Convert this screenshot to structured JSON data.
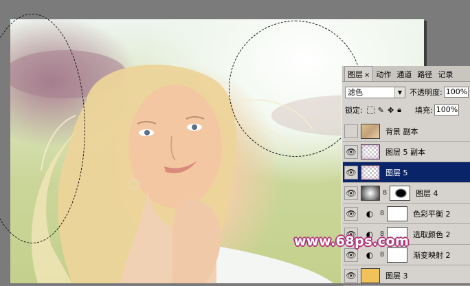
{
  "panel": {
    "tabs": [
      {
        "label": "图层",
        "close": "×",
        "active": true
      },
      {
        "label": "动作"
      },
      {
        "label": "通道"
      },
      {
        "label": "路径"
      },
      {
        "label": "记录"
      }
    ],
    "blend_mode": "滤色",
    "opacity_label": "不透明度:",
    "opacity_value": "100%",
    "lock_label": "锁定:",
    "fill_label": "填充:",
    "fill_value": "100%",
    "layers": [
      {
        "name": "背景 副本",
        "visible": false,
        "thumb": "photo"
      },
      {
        "name": "图层 5 副本",
        "visible": true,
        "thumb": "transparent-pink"
      },
      {
        "name": "图层 5",
        "visible": true,
        "selected": true,
        "thumb": "transparent-pink"
      },
      {
        "name": "图层 4",
        "visible": true,
        "thumb": "gradient",
        "mask": "black-blob"
      },
      {
        "name": "色彩平衡 2",
        "visible": true,
        "adjustment": true
      },
      {
        "name": "选取颜色 2",
        "visible": true,
        "adjustment": true
      },
      {
        "name": "渐变映射 2",
        "visible": true,
        "adjustment": true
      },
      {
        "name": "图层 3",
        "visible": true,
        "thumb": "orange"
      }
    ]
  },
  "watermark": "www.68ps.com",
  "colors": {
    "selected_layer": "#0a246a",
    "panel_bg": "#d6d3ce",
    "watermark_outline": "#b2357a"
  }
}
